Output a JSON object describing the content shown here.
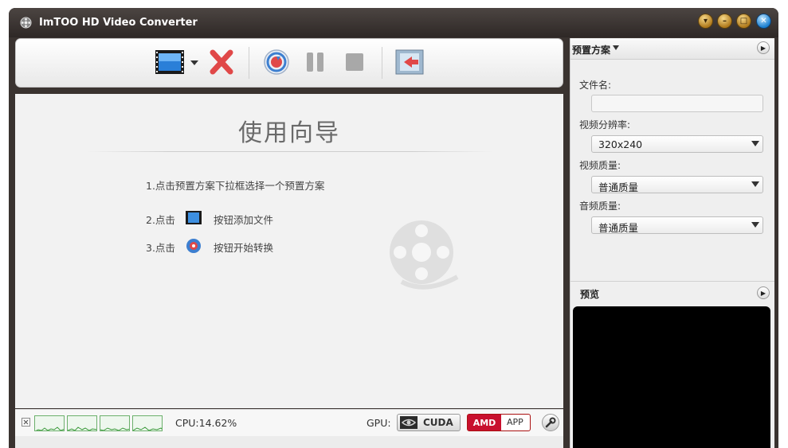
{
  "window": {
    "title": "ImTOO HD Video Converter"
  },
  "window_controls": {
    "menu": "▾",
    "minimize": "–",
    "maximize": "□",
    "close": "✕"
  },
  "toolbar": {
    "buttons": [
      "add-video-icon",
      "dropdown-caret-icon",
      "delete-icon",
      "convert-icon",
      "pause-icon",
      "stop-icon",
      "output-icon"
    ]
  },
  "guide": {
    "title": "使用向导",
    "step1": "1.点击预置方案下拉框选择一个预置方案",
    "step2_prefix": "2.点击",
    "step2_suffix": "按钮添加文件",
    "step3_prefix": "3.点击",
    "step3_suffix": "按钮开始转换"
  },
  "status": {
    "cpu": "CPU:14.62%",
    "gpu_label": "GPU:",
    "cuda": "CUDA",
    "amd_brand": "AMD",
    "amd_app": "APP"
  },
  "preset_panel": {
    "title": "预置方案",
    "filename_label": "文件名:",
    "filename_value": "",
    "resolution_label": "视频分辨率:",
    "resolution_value": "320x240",
    "video_quality_label": "视频质量:",
    "video_quality_value": "普通质量",
    "audio_quality_label": "音频质量:",
    "audio_quality_value": "普通质量"
  },
  "preview": {
    "title": "预览"
  },
  "colors": {
    "titlebar": "#3a3330",
    "accent_red": "#d33",
    "accent_blue": "#1b7fd0",
    "amd_red": "#c8102e"
  }
}
